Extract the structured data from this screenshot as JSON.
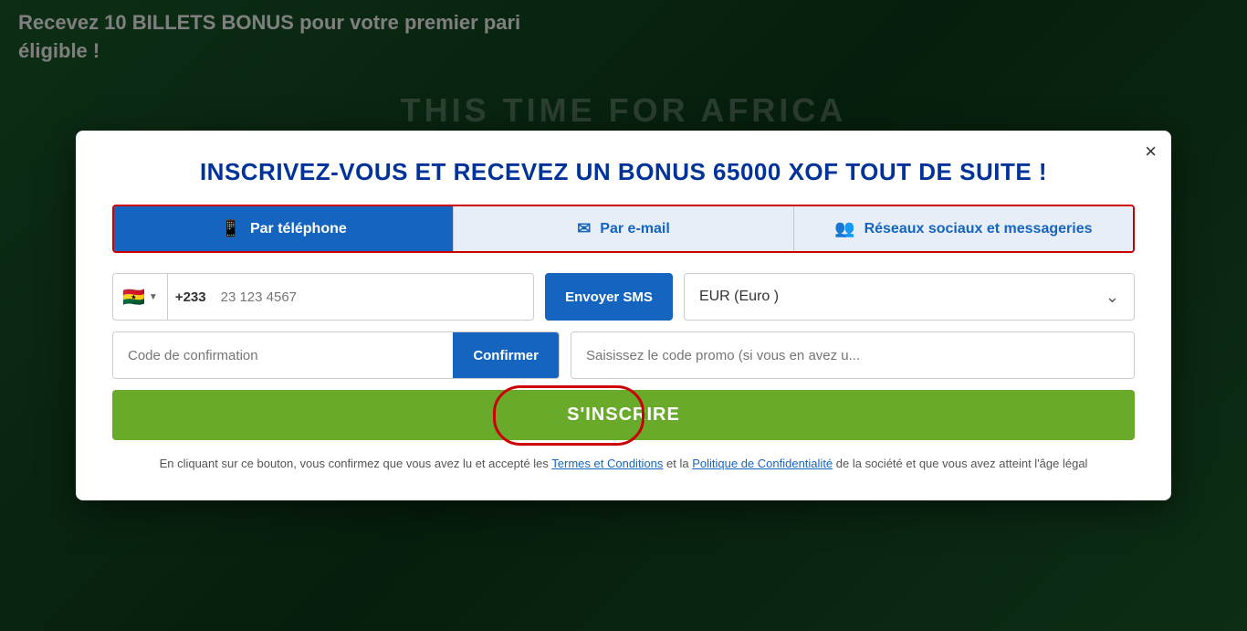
{
  "background": {
    "promo_text_line1": "Recevez 10 BILLETS BONUS pour votre premier pari",
    "promo_text_line2": "éligible !",
    "africa_text": "THIS TIME FOR AFRICA"
  },
  "modal": {
    "close_label": "×",
    "title": "INSCRIVEZ-VOUS ET RECEVEZ UN BONUS 65000 XOF TOUT DE SUITE !",
    "tabs": [
      {
        "id": "phone",
        "label": "Par téléphone",
        "icon": "📱",
        "active": true
      },
      {
        "id": "email",
        "label": "Par e-mail",
        "icon": "✉",
        "active": false
      },
      {
        "id": "social",
        "label": "Réseaux sociaux et messageries",
        "icon": "👥",
        "active": false
      }
    ],
    "form": {
      "country_flag": "🇬🇭",
      "country_code": "+233",
      "phone_placeholder": "23 123 4567",
      "sms_button": "Envoyer SMS",
      "currency_value": "EUR (Euro )",
      "confirmation_placeholder": "Code de confirmation",
      "confirm_button": "Confirmer",
      "promo_placeholder": "Saisissez le code promo (si vous en avez u...",
      "register_button": "S'INSCRIRE",
      "legal_text_before_terms": "En cliquant sur ce bouton, vous confirmez que vous avez lu et accepté les ",
      "terms_label": "Termes et Conditions",
      "legal_text_between": " et la ",
      "privacy_label": "Politique de Confidentialité",
      "legal_text_after": " de la société et que vous avez atteint l'âge légal"
    }
  }
}
